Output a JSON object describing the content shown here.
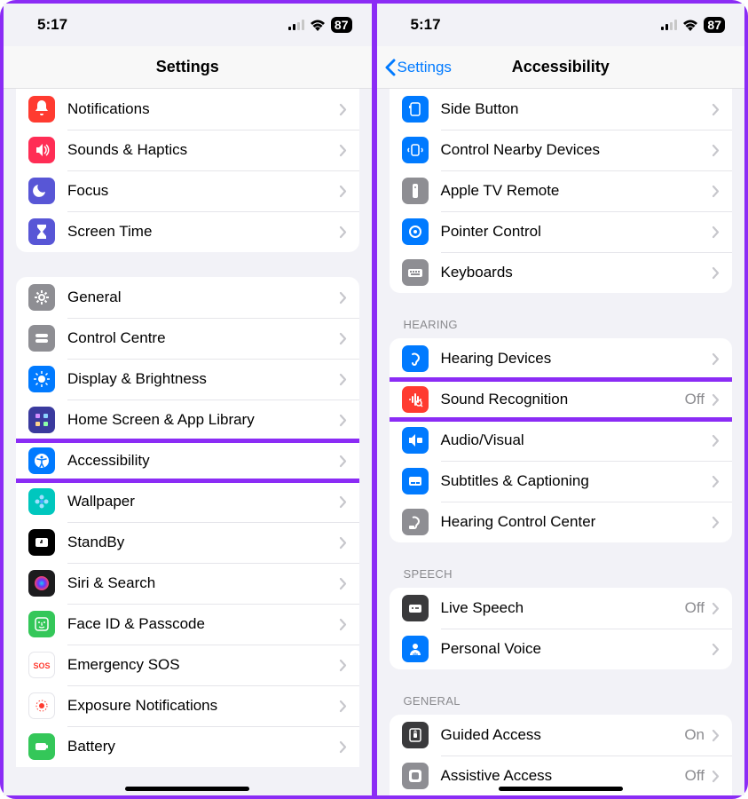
{
  "status": {
    "time": "5:17",
    "battery": "87"
  },
  "left": {
    "title": "Settings",
    "group1": [
      {
        "id": "notifications",
        "label": "Notifications",
        "iconBg": "#ff3b30",
        "icon": "bell"
      },
      {
        "id": "sounds-haptics",
        "label": "Sounds & Haptics",
        "iconBg": "#ff2d55",
        "icon": "speaker"
      },
      {
        "id": "focus",
        "label": "Focus",
        "iconBg": "#5856d6",
        "icon": "moon"
      },
      {
        "id": "screen-time",
        "label": "Screen Time",
        "iconBg": "#5856d6",
        "icon": "hourglass"
      }
    ],
    "group2": [
      {
        "id": "general",
        "label": "General",
        "iconBg": "#8e8e93",
        "icon": "gear"
      },
      {
        "id": "control-centre",
        "label": "Control Centre",
        "iconBg": "#8e8e93",
        "icon": "toggles"
      },
      {
        "id": "display-brightness",
        "label": "Display & Brightness",
        "iconBg": "#007aff",
        "icon": "brightness"
      },
      {
        "id": "home-screen",
        "label": "Home Screen & App Library",
        "iconBg": "#3a3a9e",
        "icon": "grid"
      },
      {
        "id": "accessibility",
        "label": "Accessibility",
        "iconBg": "#007aff",
        "icon": "accessibility",
        "highlight": true
      },
      {
        "id": "wallpaper",
        "label": "Wallpaper",
        "iconBg": "#00c7be",
        "icon": "flower"
      },
      {
        "id": "standby",
        "label": "StandBy",
        "iconBg": "#000000",
        "icon": "clock"
      },
      {
        "id": "siri-search",
        "label": "Siri & Search",
        "iconBg": "#1c1c1e",
        "icon": "siri"
      },
      {
        "id": "face-id",
        "label": "Face ID & Passcode",
        "iconBg": "#34c759",
        "icon": "faceid"
      },
      {
        "id": "emergency-sos",
        "label": "Emergency SOS",
        "iconBg": "#ffffff",
        "icon": "sos",
        "iconColor": "#ff3b30"
      },
      {
        "id": "exposure",
        "label": "Exposure Notifications",
        "iconBg": "#ffffff",
        "icon": "exposure",
        "iconColor": "#ff3b30"
      },
      {
        "id": "battery",
        "label": "Battery",
        "iconBg": "#34c759",
        "icon": "battery"
      }
    ]
  },
  "right": {
    "back": "Settings",
    "title": "Accessibility",
    "group1": [
      {
        "id": "side-button",
        "label": "Side Button",
        "iconBg": "#007aff",
        "icon": "sidebutton"
      },
      {
        "id": "control-nearby",
        "label": "Control Nearby Devices",
        "iconBg": "#007aff",
        "icon": "nearby"
      },
      {
        "id": "apple-tv-remote",
        "label": "Apple TV Remote",
        "iconBg": "#8e8e93",
        "icon": "remote"
      },
      {
        "id": "pointer-control",
        "label": "Pointer Control",
        "iconBg": "#007aff",
        "icon": "pointer"
      },
      {
        "id": "keyboards",
        "label": "Keyboards",
        "iconBg": "#8e8e93",
        "icon": "keyboard"
      }
    ],
    "hearingHeader": "HEARING",
    "group2": [
      {
        "id": "hearing-devices",
        "label": "Hearing Devices",
        "iconBg": "#007aff",
        "icon": "ear"
      },
      {
        "id": "sound-recognition",
        "label": "Sound Recognition",
        "iconBg": "#ff3b30",
        "icon": "soundwave",
        "value": "Off",
        "highlight": true
      },
      {
        "id": "audio-visual",
        "label": "Audio/Visual",
        "iconBg": "#007aff",
        "icon": "audiovisual"
      },
      {
        "id": "subtitles",
        "label": "Subtitles & Captioning",
        "iconBg": "#007aff",
        "icon": "subtitles"
      },
      {
        "id": "hearing-control",
        "label": "Hearing Control Center",
        "iconBg": "#8e8e93",
        "icon": "hearingcontrol"
      }
    ],
    "speechHeader": "SPEECH",
    "group3": [
      {
        "id": "live-speech",
        "label": "Live Speech",
        "iconBg": "#3a3a3c",
        "icon": "livespeech",
        "value": "Off"
      },
      {
        "id": "personal-voice",
        "label": "Personal Voice",
        "iconBg": "#007aff",
        "icon": "personalvoice"
      }
    ],
    "generalHeader": "GENERAL",
    "group4": [
      {
        "id": "guided-access",
        "label": "Guided Access",
        "iconBg": "#3a3a3c",
        "icon": "guided",
        "value": "On"
      },
      {
        "id": "assistive-access",
        "label": "Assistive Access",
        "iconBg": "#8e8e93",
        "icon": "assistive",
        "value": "Off"
      }
    ]
  }
}
